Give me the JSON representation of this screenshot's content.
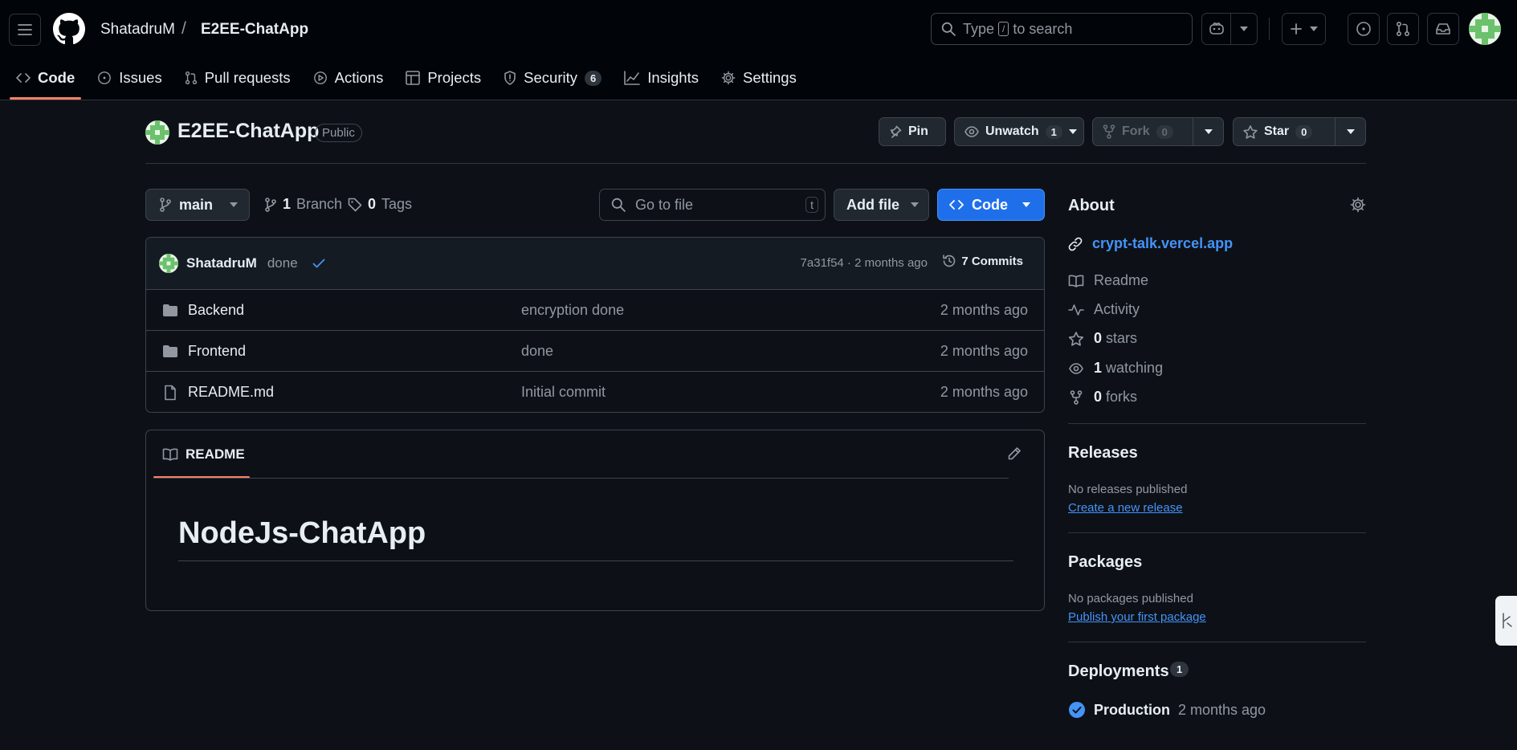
{
  "header": {
    "owner": "ShatadruM",
    "separator": "/",
    "repo": "E2EE-ChatApp",
    "search_prefix": "Type",
    "search_key": "/",
    "search_suffix": "to search"
  },
  "nav_tabs": [
    {
      "label": "Code",
      "icon": "code-icon",
      "selected": true
    },
    {
      "label": "Issues",
      "icon": "issue-icon"
    },
    {
      "label": "Pull requests",
      "icon": "pull-request-icon"
    },
    {
      "label": "Actions",
      "icon": "play-icon"
    },
    {
      "label": "Projects",
      "icon": "table-icon"
    },
    {
      "label": "Security",
      "icon": "shield-icon",
      "count": "6"
    },
    {
      "label": "Insights",
      "icon": "graph-icon"
    },
    {
      "label": "Settings",
      "icon": "gear-icon"
    }
  ],
  "repo": {
    "title": "E2EE-ChatApp",
    "visibility": "Public",
    "pin_label": "Pin",
    "unwatch_label": "Unwatch",
    "watch_count": "1",
    "fork_label": "Fork",
    "fork_count": "0",
    "star_label": "Star",
    "star_count": "0"
  },
  "branch": {
    "name": "main",
    "branch_count": "1",
    "branch_label": "Branch",
    "tag_count": "0",
    "tag_label": "Tags",
    "goto_placeholder": "Go to file",
    "goto_key": "t",
    "add_file_label": "Add file",
    "code_label": "Code"
  },
  "commit": {
    "author": "ShatadruM",
    "message": "done",
    "meta": "7a31f54 · 2 months ago",
    "commits_label": "7 Commits"
  },
  "files": [
    {
      "name": "Backend",
      "type": "folder",
      "message": "encryption done",
      "time": "2 months ago"
    },
    {
      "name": "Frontend",
      "type": "folder",
      "message": "done",
      "time": "2 months ago"
    },
    {
      "name": "README.md",
      "type": "file",
      "message": "Initial commit",
      "time": "2 months ago"
    }
  ],
  "readme": {
    "tab_label": "README",
    "heading": "NodeJs-ChatApp"
  },
  "about": {
    "title": "About",
    "website": "crypt-talk.vercel.app",
    "readme_label": "Readme",
    "activity_label": "Activity",
    "stars_count": "0",
    "stars_label": "stars",
    "watching_count": "1",
    "watching_label": "watching",
    "forks_count": "0",
    "forks_label": "forks"
  },
  "releases": {
    "title": "Releases",
    "empty_text": "No releases published",
    "create_link": "Create a new release"
  },
  "packages": {
    "title": "Packages",
    "empty_text": "No packages published",
    "publish_link": "Publish your first package"
  },
  "deployments": {
    "title": "Deployments",
    "count": "1",
    "env": "Production",
    "time": "2 months ago"
  },
  "colors": {
    "accent_blue": "#1f6feb",
    "link_blue": "#4493f8",
    "selected_underline": "#f78166",
    "background": "#0d1117"
  }
}
